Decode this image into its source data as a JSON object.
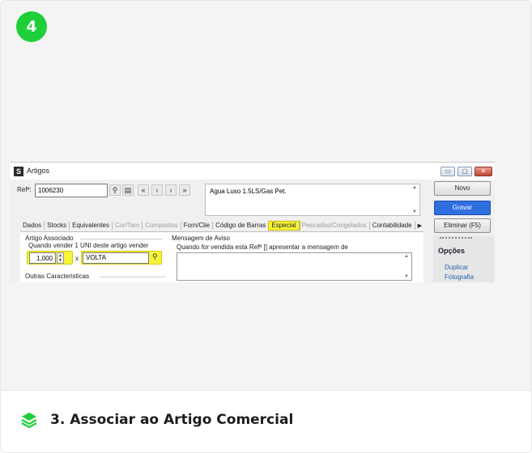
{
  "step": {
    "number": "4"
  },
  "window": {
    "title": "Artigos",
    "icon_letter": "S",
    "buttons": {
      "minimize": "▭",
      "restore": "▢",
      "close": "✕"
    }
  },
  "header": {
    "ref_label": "Refª:",
    "ref_value": "1006230",
    "description": "Agua Luso 1.5LS/Gas Pet."
  },
  "tabs": [
    {
      "label": "Dados",
      "state": "normal"
    },
    {
      "label": "Stocks",
      "state": "normal"
    },
    {
      "label": "Equivalentes",
      "state": "normal"
    },
    {
      "label": "Cor/Tam",
      "state": "dim"
    },
    {
      "label": "Compostos",
      "state": "dim"
    },
    {
      "label": "Forn/Clie",
      "state": "normal"
    },
    {
      "label": "Código de Barras",
      "state": "normal"
    },
    {
      "label": "Especial",
      "state": "active"
    },
    {
      "label": "Pescados/Congelados",
      "state": "dim"
    },
    {
      "label": "Contabilidade",
      "state": "normal"
    }
  ],
  "artigo_associado": {
    "group_label": "Artigo Associado",
    "prompt": "Quando vender 1 UNI deste artigo vender",
    "quantity": "1,000",
    "times": "x",
    "artigo_value": "VOLTA"
  },
  "mensagem_aviso": {
    "group_label": "Mensagem de Aviso",
    "prompt": "Quando for vendida esta Refª [] apresentar a mensagem de"
  },
  "outras": {
    "label": "Outras Caracteristicas"
  },
  "side": {
    "novo": "Novo",
    "gravar": "Gravar",
    "eliminar": "Eliminar (F5)",
    "opcoes_title": "Opções",
    "options": [
      "Duplicar",
      "Fotografia"
    ]
  },
  "footer": {
    "title": "3. Associar ao Artigo Comercial"
  },
  "colors": {
    "accent_green": "#1fcf3a",
    "highlight": "#f8f43a",
    "primary_blue": "#2f6fe0"
  }
}
